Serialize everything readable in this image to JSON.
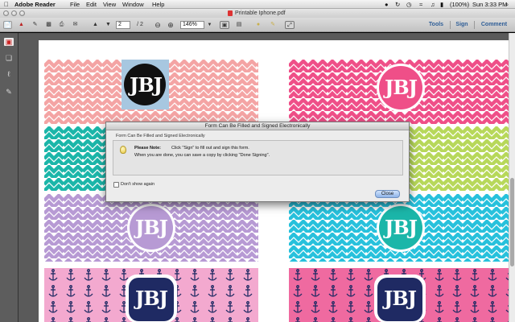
{
  "menubar": {
    "apple_icon": "apple-icon",
    "items": [
      "Adobe Reader",
      "File",
      "Edit",
      "View",
      "Window",
      "Help"
    ],
    "status": {
      "battery": "(100%)",
      "clock": "Sun 3:33 PM"
    }
  },
  "window": {
    "title": "Printable Iphone.pdf"
  },
  "toolbar": {
    "page_current": "2",
    "page_total": "/ 2",
    "zoom": "146%",
    "tools_label": "Tools",
    "sign_label": "Sign",
    "comment_label": "Comment"
  },
  "document": {
    "monogram": "JBJ",
    "colors": {
      "coral": "#f4a4a4",
      "hot_pink": "#ef4f88",
      "teal": "#1bb6a9",
      "lime": "#b7d85a",
      "lavender": "#b79ad4",
      "cyan": "#27c1dc",
      "light_pink": "#f3a9cf",
      "pink_dark": "#ef6aa0",
      "navy": "#1f2a63",
      "light_blue": "#a7c7e0"
    }
  },
  "dialog": {
    "title": "Form Can Be Filled and Signed Electronically",
    "heading": "Form Can Be Filled and Signed Electronically",
    "note_label": "Please Note:",
    "note_line1": "Click \"Sign\" to fill out and sign this form.",
    "note_line2": "When you are done, you can save a copy by clicking \"Done Signing\".",
    "checkbox_label": "Don't show again",
    "close_label": "Close"
  }
}
